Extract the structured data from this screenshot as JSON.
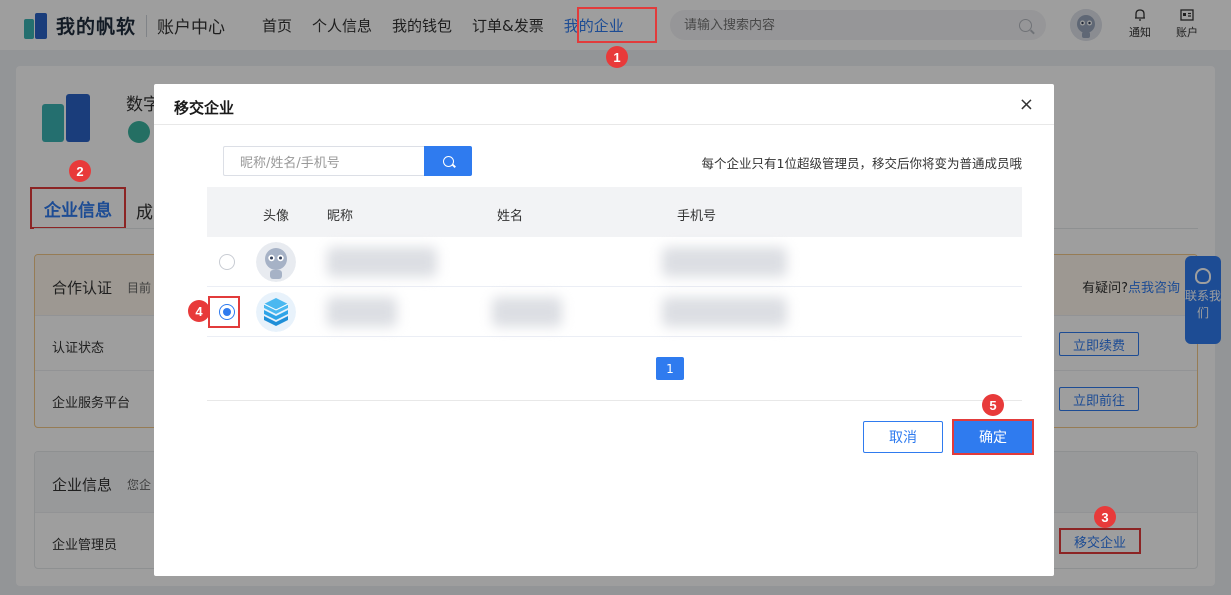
{
  "header": {
    "brand": "我的帆软",
    "sub_title": "账户中心",
    "nav": [
      "首页",
      "个人信息",
      "我的钱包",
      "订单&发票",
      "我的企业"
    ],
    "search_placeholder": "请输入搜索内容",
    "notify_label": "通知",
    "account_label": "账户"
  },
  "page": {
    "enterprise_name": "数字",
    "tabs": [
      "企业信息",
      "成"
    ],
    "coop": {
      "title": "合作认证",
      "desc": "目前",
      "ask": "有疑问?",
      "ask_link": "点我咨询",
      "rows": [
        {
          "label": "认证状态",
          "button": "立即续费"
        },
        {
          "label": "企业服务平台",
          "button": "立即前往"
        }
      ]
    },
    "ent_info": {
      "title": "企业信息",
      "desc": "您企",
      "admin_label": "企业管理员",
      "transfer_button": "移交企业"
    },
    "contact": "联系我们"
  },
  "modal": {
    "title": "移交企业",
    "close": "×",
    "search_placeholder": "昵称/姓名/手机号",
    "tip": "每个企业只有1位超级管理员，移交后你将变为普通成员哦",
    "columns": [
      "头像",
      "昵称",
      "姓名",
      "手机号"
    ],
    "rows": [
      {
        "selected": false
      },
      {
        "selected": true
      }
    ],
    "page": "1",
    "cancel": "取消",
    "confirm": "确定"
  },
  "steps": [
    "1",
    "2",
    "3",
    "4",
    "5"
  ],
  "colors": {
    "accent": "#2f7bef",
    "highlight": "#e23b3b",
    "step": "#e83a3a"
  }
}
